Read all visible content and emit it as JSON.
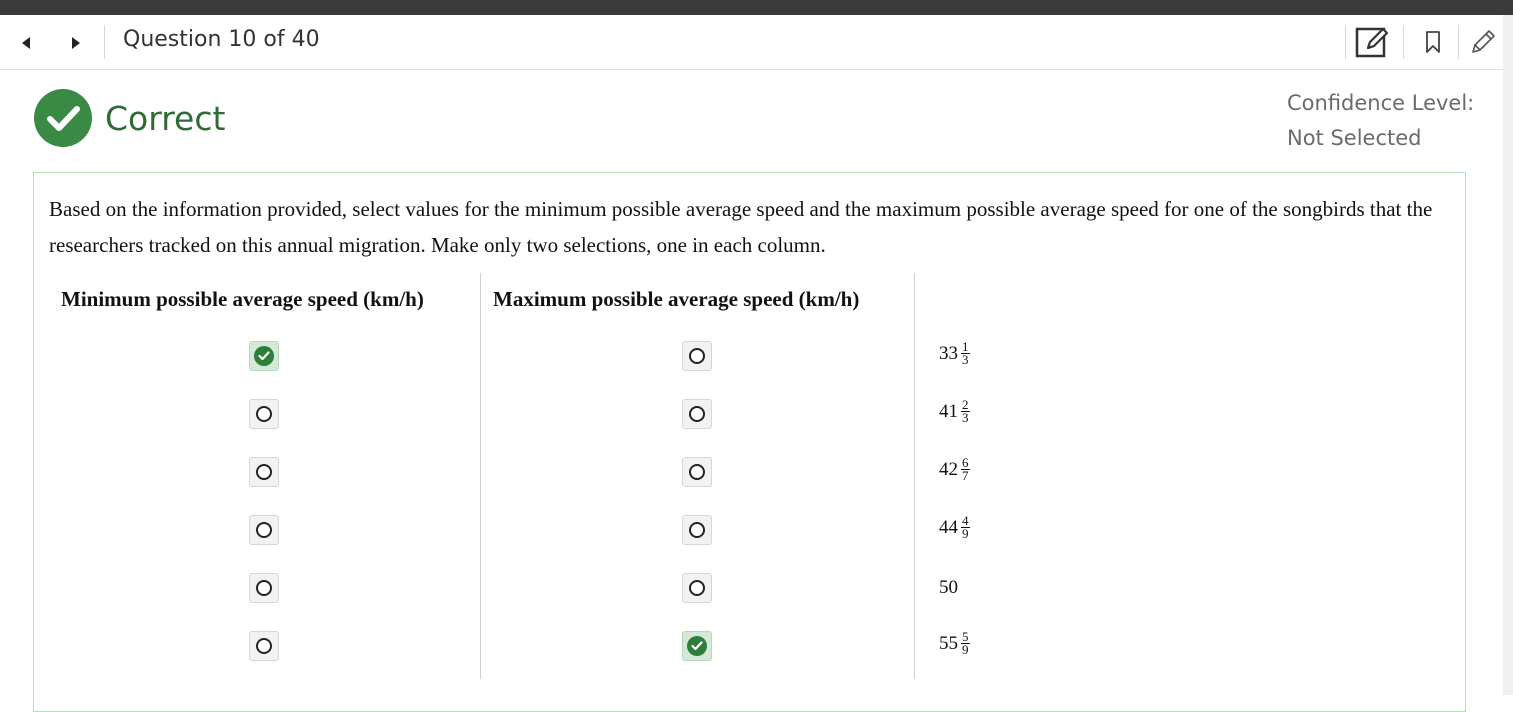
{
  "navbar": {
    "question_counter": "Question 10 of 40",
    "prev_icon": "triangle-left-icon",
    "next_icon": "triangle-right-icon",
    "tools": [
      "notepad-edit-icon",
      "bookmark-icon",
      "pencil-icon"
    ]
  },
  "result": {
    "status": "Correct",
    "icon": "check-circle-icon",
    "color": "#2e6b37"
  },
  "confidence": {
    "label": "Confidence Level:",
    "value": "Not Selected"
  },
  "question": {
    "prompt": "Based on the information provided, select values for the minimum possible average speed and the maximum possible average speed for one of the songbirds that the researchers tracked on this annual migration. Make only two selections, one in each column.",
    "columns": [
      "Minimum possible average speed (km/h)",
      "Maximum possible average speed (km/h)"
    ],
    "options": [
      {
        "whole": "33",
        "num": "1",
        "den": "3",
        "min_selected": true,
        "max_selected": false
      },
      {
        "whole": "41",
        "num": "2",
        "den": "3",
        "min_selected": false,
        "max_selected": false
      },
      {
        "whole": "42",
        "num": "6",
        "den": "7",
        "min_selected": false,
        "max_selected": false
      },
      {
        "whole": "44",
        "num": "4",
        "den": "9",
        "min_selected": false,
        "max_selected": false
      },
      {
        "whole": "50",
        "num": "",
        "den": "",
        "min_selected": false,
        "max_selected": false
      },
      {
        "whole": "55",
        "num": "5",
        "den": "9",
        "min_selected": false,
        "max_selected": true
      }
    ]
  },
  "colors": {
    "accent_green": "#2e7d3a",
    "selected_bg": "#d5e9d8",
    "panel_border": "#b9dfbf",
    "topbar": "#3b3b3b"
  }
}
